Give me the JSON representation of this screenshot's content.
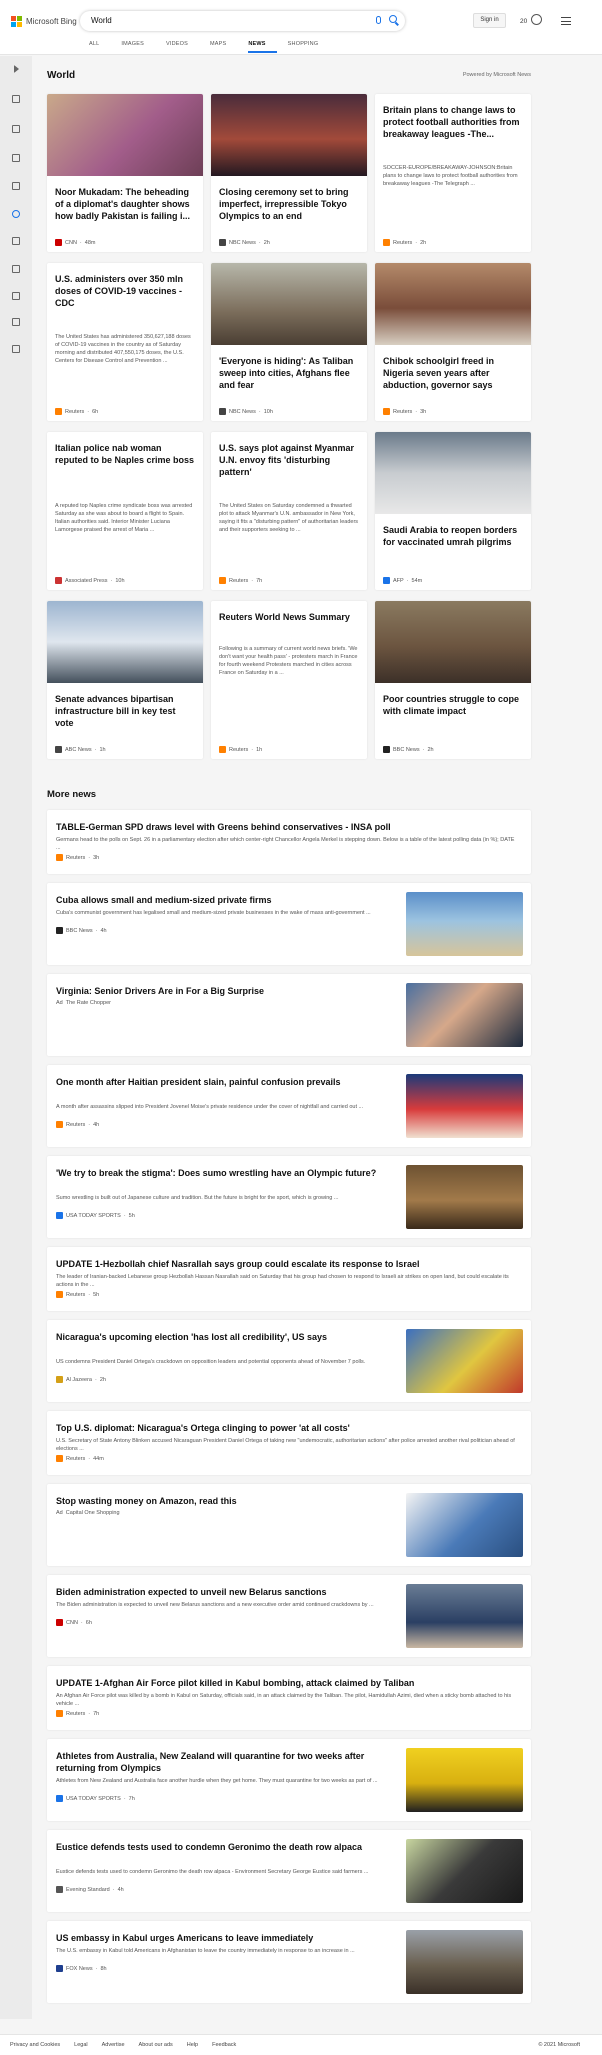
{
  "app": {
    "logo_text": "Microsoft Bing",
    "search_value": "World",
    "signin": "Sign in",
    "rewards_count": "20",
    "tabs": [
      "ALL",
      "IMAGES",
      "VIDEOS",
      "MAPS",
      "NEWS",
      "SHOPPING"
    ],
    "active_tab": "NEWS"
  },
  "section": {
    "title": "World",
    "powered_by": "Powered by Microsoft News"
  },
  "cards": [
    {
      "title": "Noor Mukadam: The beheading of a diplomat's daughter shows how badly Pakistan is failing i...",
      "desc": "",
      "source": "CNN",
      "time": "48m",
      "logo_color": "#cc0000",
      "img_icon": "woman-portrait"
    },
    {
      "title": "Closing ceremony set to bring imperfect, irrepressible Tokyo Olympics to an end",
      "desc": "",
      "source": "NBC News",
      "time": "2h",
      "logo_color": "#444444",
      "img_icon": "olympic-rings"
    },
    {
      "title": "Britain plans to change laws to protect football authorities from breakaway leagues -The...",
      "desc": "SOCCER-EUROPE/BREAKAWAY-JOHNSON:Britain plans to change laws to protect football authorities from breakaway leagues -The Telegraph ...",
      "source": "Reuters",
      "time": "2h",
      "logo_color": "#ff8000",
      "img_icon": ""
    },
    {
      "title": "U.S. administers over 350 mln doses of COVID-19 vaccines - CDC",
      "desc": "The United States has administered 350,627,188 doses of COVID-19 vaccines in the country as of Saturday morning and distributed 407,550,175 doses, the U.S. Centers for Disease Control and Prevention ...",
      "source": "Reuters",
      "time": "6h",
      "logo_color": "#ff8000",
      "img_icon": ""
    },
    {
      "title": "'Everyone is hiding': As Taliban sweep into cities, Afghans flee and fear",
      "desc": "",
      "source": "NBC News",
      "time": "10h",
      "logo_color": "#444444",
      "img_icon": "crowd"
    },
    {
      "title": "Chibok schoolgirl freed in Nigeria seven years after abduction, governor says",
      "desc": "",
      "source": "Reuters",
      "time": "3h",
      "logo_color": "#ff8000",
      "img_icon": "classroom"
    },
    {
      "title": "Italian police nab woman reputed to be Naples crime boss",
      "desc": "A reputed top Naples crime syndicate boss was arrested Saturday as she was about to board a flight to Spain. Italian authorities said. Interior Minister Luciana Lamorgese praised the arrest of Maria ...",
      "source": "Associated Press",
      "time": "10h",
      "logo_color": "#cc3333",
      "img_icon": ""
    },
    {
      "title": "U.S. says plot against Myanmar U.N. envoy fits 'disturbing pattern'",
      "desc": "The United States on Saturday condemned a thwarted plot to attack Myanmar's U.N. ambassador in New York, saying it fits a \"disturbing pattern\" of authoritarian leaders and their supporters seeking to ...",
      "source": "Reuters",
      "time": "7h",
      "logo_color": "#ff8000",
      "img_icon": ""
    },
    {
      "title": "Saudi Arabia to reopen borders for vaccinated umrah pilgrims",
      "desc": "",
      "source": "AFP",
      "time": "54m",
      "logo_color": "#1a73e8",
      "img_icon": "kaaba"
    },
    {
      "title": "Senate advances bipartisan infrastructure bill in key test vote",
      "desc": "",
      "source": "ABC News",
      "time": "1h",
      "logo_color": "#444444",
      "img_icon": "capitol"
    },
    {
      "title": "Reuters World News Summary",
      "desc": "Following is a summary of current world news briefs. 'We don't want your health pass' - protesters march in France for fourth weekend Protesters marched in cities across France on Saturday in a ...",
      "source": "Reuters",
      "time": "1h",
      "logo_color": "#ff8000",
      "img_icon": ""
    },
    {
      "title": "Poor countries struggle to cope with climate impact",
      "desc": "",
      "source": "BBC News",
      "time": "2h",
      "logo_color": "#222222",
      "img_icon": "flood"
    }
  ],
  "more": {
    "title": "More news",
    "items": [
      {
        "title": "TABLE-German SPD draws level with Greens behind conservatives - INSA poll",
        "desc": "Germans head to the polls on Sept. 26 in a parliamentary election after which center-right Chancellor Angela Merkel is stepping down. Below is a table of the latest polling data (in %); DATE ...",
        "source": "Reuters",
        "time": "3h",
        "logo_color": "#ff8000",
        "ad": false,
        "thumb": ""
      },
      {
        "title": "Cuba allows small and medium-sized private firms",
        "desc": "Cuba's communist government has legalised small and medium-sized private businesses in the wake of mass anti-government ...",
        "source": "BBC News",
        "time": "4h",
        "logo_color": "#222222",
        "ad": false,
        "thumb": "beach"
      },
      {
        "title": "Virginia: Senior Drivers Are in For a Big Surprise",
        "desc": "",
        "source": "The Rate Chopper",
        "time": "",
        "logo_color": "",
        "ad": true,
        "ad_label": "Ad",
        "thumb": "face"
      },
      {
        "title": "One month after Haitian president slain, painful confusion prevails",
        "desc": "A month after assassins slipped into President Jovenel Moise's private residence under the cover of nightfall and carried out ...",
        "source": "Reuters",
        "time": "4h",
        "logo_color": "#ff8000",
        "ad": false,
        "thumb": "memorial"
      },
      {
        "title": "'We try to break the stigma': Does sumo wrestling have an Olympic future?",
        "desc": "Sumo wrestling is built out of Japanese culture and tradition. But the future is bright for the sport, which is growing ...",
        "source": "USA TODAY SPORTS",
        "time": "5h",
        "logo_color": "#1a73e8",
        "ad": false,
        "thumb": "sumo"
      },
      {
        "title": "UPDATE 1-Hezbollah chief Nasrallah says group could escalate its response to Israel",
        "desc": "The leader of Iranian-backed Lebanese group Hezbollah Hassan Nasrallah said on Saturday that his group had chosen to respond to Israeli air strikes on open land, but could escalate its actions in the ...",
        "source": "Reuters",
        "time": "5h",
        "logo_color": "#ff8000",
        "ad": false,
        "thumb": ""
      },
      {
        "title": "Nicaragua's upcoming election 'has lost all credibility', US says",
        "desc": "US condemns President Daniel Ortega's crackdown on opposition leaders and potential opponents ahead of November 7 polls.",
        "source": "Al Jazeera",
        "time": "2h",
        "logo_color": "#d4a017",
        "ad": false,
        "thumb": "mural"
      },
      {
        "title": "Top U.S. diplomat: Nicaragua's Ortega clinging to power 'at all costs'",
        "desc": "U.S. Secretary of State Antony Blinken accused Nicaraguan President Daniel Ortega of taking new \"undemocratic, authoritarian actions\" after police arrested another rival politician ahead of elections ...",
        "source": "Reuters",
        "time": "44m",
        "logo_color": "#ff8000",
        "ad": false,
        "thumb": ""
      },
      {
        "title": "Stop wasting money on Amazon, read this",
        "desc": "",
        "source": "Capital One Shopping",
        "time": "",
        "logo_color": "",
        "ad": true,
        "ad_label": "Ad",
        "thumb": "package"
      },
      {
        "title": "Biden administration expected to unveil new Belarus sanctions",
        "desc": "The Biden administration is expected to unveil new Belarus sanctions and a new executive order amid continued crackdowns by ...",
        "source": "CNN",
        "time": "6h",
        "logo_color": "#cc0000",
        "ad": false,
        "thumb": "meeting"
      },
      {
        "title": "UPDATE 1-Afghan Air Force pilot killed in Kabul bombing, attack claimed by Taliban",
        "desc": "An Afghan Air Force pilot was killed by a bomb in Kabul on Saturday, officials said, in an attack claimed by the Taliban. The pilot, Hamidullah Azimi, died when a sticky bomb attached to his vehicle ...",
        "source": "Reuters",
        "time": "7h",
        "logo_color": "#ff8000",
        "ad": false,
        "thumb": ""
      },
      {
        "title": "Athletes from Australia, New Zealand will quarantine for two weeks after returning from Olympics",
        "desc": "Athletes from New Zealand and Australia face another hurdle when they get home. They must quarantine for two weeks as part of ...",
        "source": "USA TODAY SPORTS",
        "time": "7h",
        "logo_color": "#1a73e8",
        "ad": false,
        "thumb": "athletes"
      },
      {
        "title": "Eustice defends tests used to condemn Geronimo the death row alpaca",
        "desc": "Eustice defends tests used to condemn Geronimo the death row alpaca - Environment Secretary George Eustice said farmers ...",
        "source": "Evening Standard",
        "time": "4h",
        "logo_color": "#555555",
        "ad": false,
        "thumb": "alpaca"
      },
      {
        "title": "US embassy in Kabul urges Americans to leave immediately",
        "desc": "The U.S. embassy in Kabul told Americans in Afghanistan to leave the country immediately in response to an increase in ...",
        "source": "FOX News",
        "time": "8h",
        "logo_color": "#1f3f8f",
        "ad": false,
        "thumb": "kabul"
      }
    ]
  },
  "footer": {
    "links": [
      "Privacy and Cookies",
      "Legal",
      "Advertise",
      "About our ads",
      "Help",
      "Feedback"
    ],
    "copyright": "© 2021 Microsoft"
  }
}
